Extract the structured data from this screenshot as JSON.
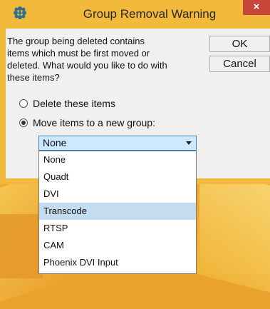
{
  "window": {
    "title": "Group Removal Warning",
    "close_label": "×"
  },
  "message": "The group being deleted contains\n items which must be first moved or\ndeleted.  What would you like to do with\nthese items?",
  "buttons": {
    "ok": "OK",
    "cancel": "Cancel"
  },
  "options": [
    {
      "label": "Delete these items",
      "checked": false
    },
    {
      "label": "Move items to a new group:",
      "checked": true
    }
  ],
  "group_select": {
    "selected": "None",
    "items": [
      "None",
      "Quadt",
      "DVI",
      "Transcode",
      "RTSP",
      "CAM",
      "Phoenix DVI Input"
    ],
    "highlighted_index": 3
  }
}
